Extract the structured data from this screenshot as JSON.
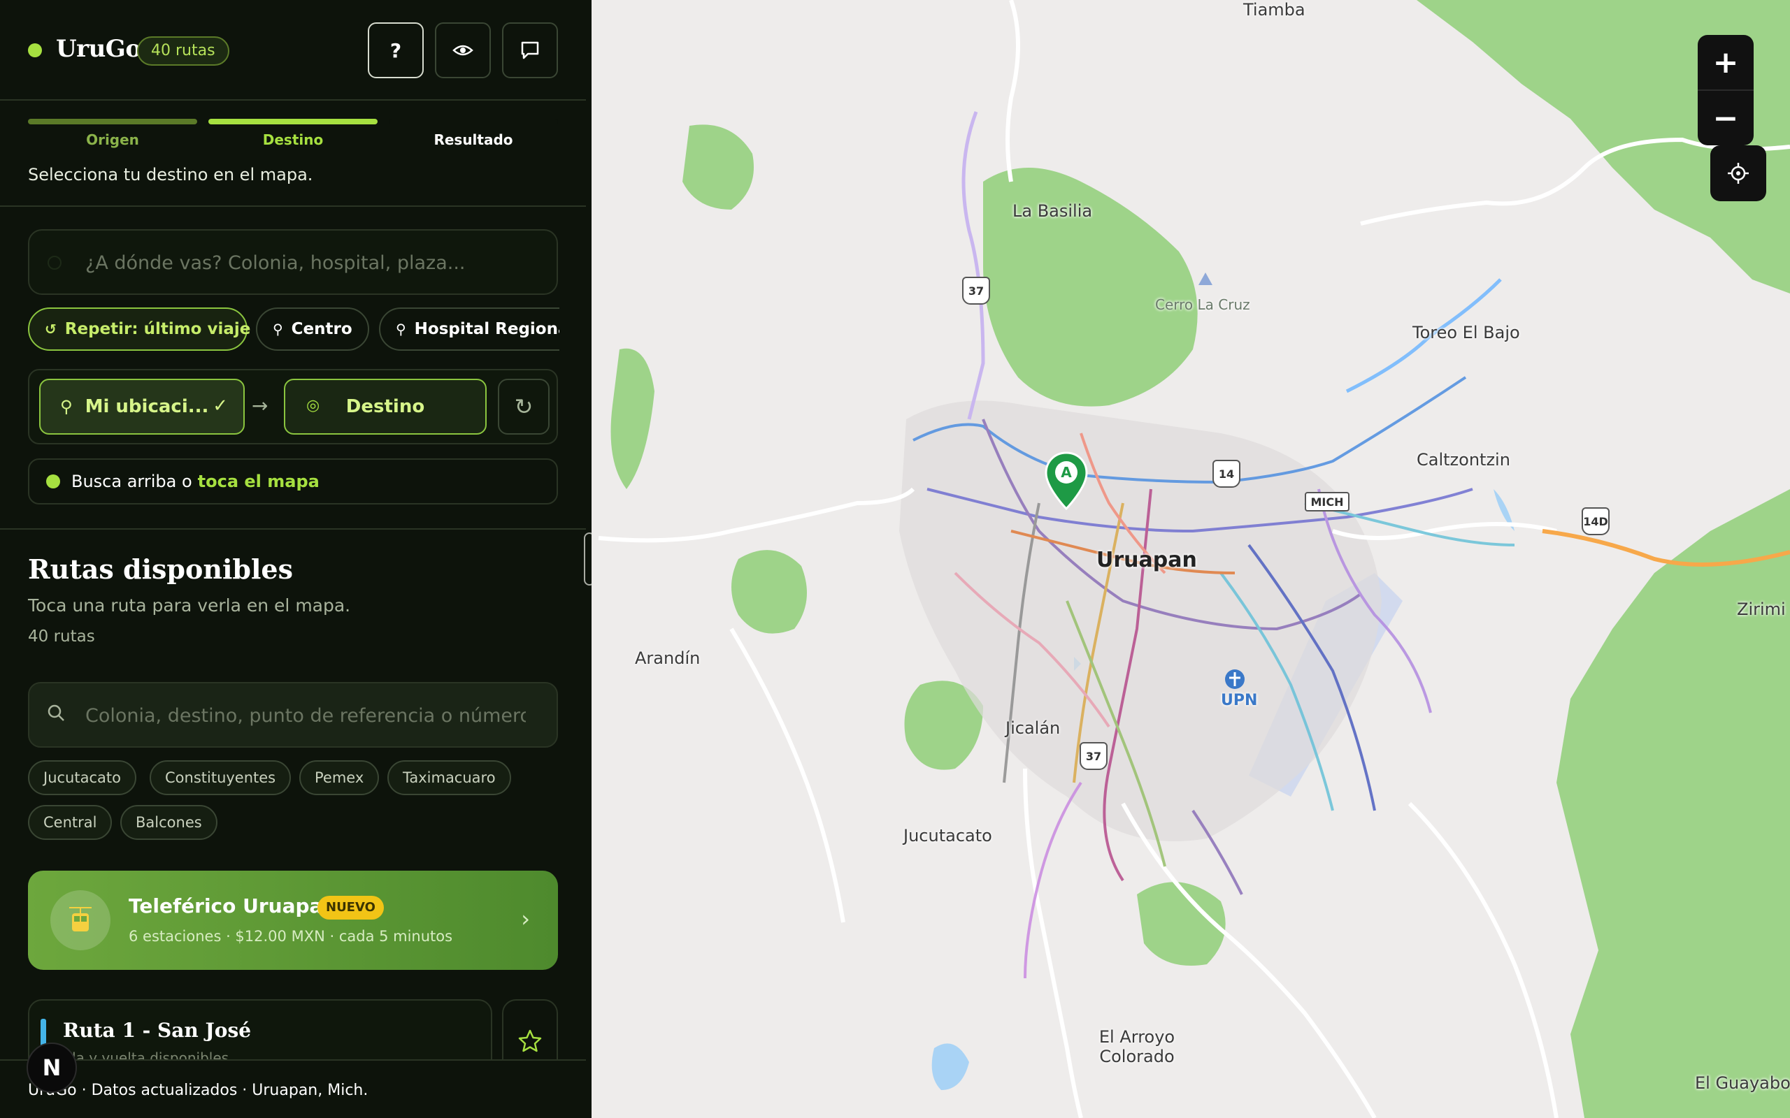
{
  "app": {
    "name": "UruGo",
    "route_count_badge": "40 rutas",
    "accent_color": "#a6e040",
    "header_buttons": [
      {
        "icon": "question-icon",
        "glyph": "?"
      },
      {
        "icon": "eye-icon",
        "glyph": "◉"
      },
      {
        "icon": "chat-icon",
        "glyph": "▭"
      }
    ]
  },
  "steps": {
    "items": [
      {
        "label": "Origen",
        "state": "done"
      },
      {
        "label": "Destino",
        "state": "active"
      },
      {
        "label": "Resultado",
        "state": "pending"
      }
    ],
    "hint": "Selecciona tu destino en el mapa."
  },
  "search": {
    "placeholder": "¿A dónde vas? Colonia, hospital, plaza...",
    "value": ""
  },
  "quick_chips": [
    {
      "label": "Repetir: último viaje",
      "icon": "history-icon",
      "glyph": "↺"
    },
    {
      "label": "Centro",
      "icon": "pin-icon",
      "glyph": "⚲"
    },
    {
      "label": "Hospital Regional",
      "icon": "pin-icon",
      "glyph": "⚲"
    }
  ],
  "od": {
    "origin_label": "Mi ubicaci...",
    "origin_check": "✓",
    "arrow": "→",
    "destination_label": "Destino",
    "reset_glyph": "↻"
  },
  "hint": {
    "prefix": "Busca arriba o",
    "link": "toca el mapa"
  },
  "routes": {
    "title": "Rutas disponibles",
    "subtitle": "Toca una ruta para verla en el mapa.",
    "count": "40 rutas",
    "search_placeholder": "Colonia, destino, punto de referencia o número",
    "tags": [
      "Jucutacato",
      "Constituyentes",
      "Pemex",
      "Taximacuaro",
      "Central",
      "Balcones"
    ],
    "featured": {
      "title": "Teleférico Uruapan",
      "badge": "NUEVO",
      "meta": "6 estaciones · $12.00 MXN · cada 5 minutos",
      "icon": "cable-car-icon"
    },
    "list": [
      {
        "title": "Ruta 1 - San José",
        "subtitle": "Ida y vuelta disponibles",
        "color": "#44b4e8"
      }
    ]
  },
  "footer": {
    "text": "UruGo · Datos actualizados · Uruapan, Mich.",
    "badge": "N"
  },
  "map": {
    "places": [
      {
        "name": "Tiamba",
        "kind": "town"
      },
      {
        "name": "La Basilia",
        "kind": "town"
      },
      {
        "name": "Cerro La Cruz",
        "kind": "peak"
      },
      {
        "name": "Toreo El Bajo",
        "kind": "town"
      },
      {
        "name": "Caltzontzin",
        "kind": "town"
      },
      {
        "name": "Uruapan",
        "kind": "city"
      },
      {
        "name": "Arandín",
        "kind": "town"
      },
      {
        "name": "Zirimi",
        "kind": "town"
      },
      {
        "name": "UPN",
        "kind": "airport"
      },
      {
        "name": "Jicalán",
        "kind": "town"
      },
      {
        "name": "Jucutacato",
        "kind": "town"
      },
      {
        "name": "El Arroyo Colorado",
        "kind": "town"
      },
      {
        "name": "El Guayabo",
        "kind": "town"
      }
    ],
    "shields": [
      "37",
      "14",
      "MICH",
      "14D",
      "37"
    ],
    "marker_label": "A",
    "controls": {
      "zoom_in": "+",
      "zoom_out": "−",
      "locate_glyph": "⌖"
    }
  }
}
